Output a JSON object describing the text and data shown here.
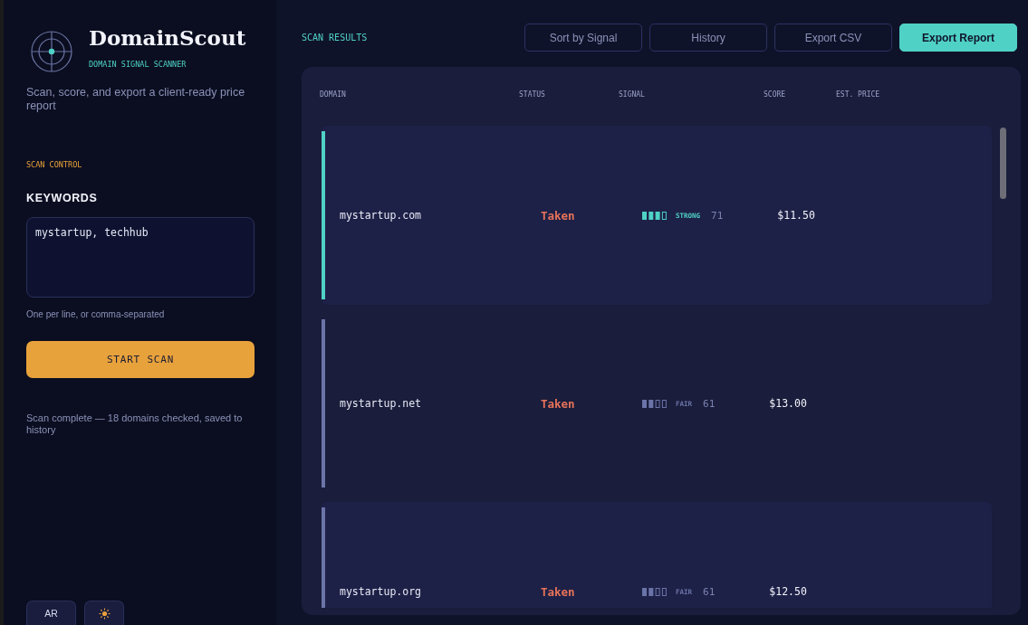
{
  "sidebar": {
    "brand": {
      "title": "DomainScout",
      "subtitle": "DOMAIN SIGNAL SCANNER"
    },
    "tagline": "Scan, score, and export a client-ready price report",
    "section_label": "SCAN CONTROL",
    "keywords": {
      "label": "KEYWORDS",
      "value": "mystartup, techhub",
      "hint": "One per line, or comma-separated"
    },
    "start_button": "START SCAN",
    "status_message": "Scan complete — 18 domains checked, saved to history",
    "footer_buttons": [
      {
        "kind": "language",
        "label": "AR"
      },
      {
        "kind": "theme"
      }
    ]
  },
  "results": {
    "title": "SCAN RESULTS",
    "actions": [
      {
        "label": "Sort by Signal",
        "primary": false
      },
      {
        "label": "History",
        "primary": false
      },
      {
        "label": "Export CSV",
        "primary": false
      },
      {
        "label": "Export Report",
        "primary": true
      }
    ],
    "columns": [
      "DOMAIN",
      "STATUS",
      "SIGNAL",
      "SCORE",
      "EST. PRICE"
    ],
    "rows": [
      {
        "domain": "mystartup.com",
        "status": "Taken",
        "signal": {
          "level": 0.75,
          "label": "STRONG",
          "color": "#4fd1c5"
        },
        "score": "71",
        "price": "$11.50"
      },
      {
        "domain": "mystartup.net",
        "status": "Taken",
        "signal": {
          "level": 0.5,
          "label": "FAIR",
          "color": "#6b74a8"
        },
        "score": "61",
        "price": "$13.00"
      },
      {
        "domain": "mystartup.org",
        "status": "Taken",
        "signal": {
          "level": 0.5,
          "label": "FAIR",
          "color": "#6b74a8"
        },
        "score": "61",
        "price": "$12.50"
      }
    ]
  }
}
